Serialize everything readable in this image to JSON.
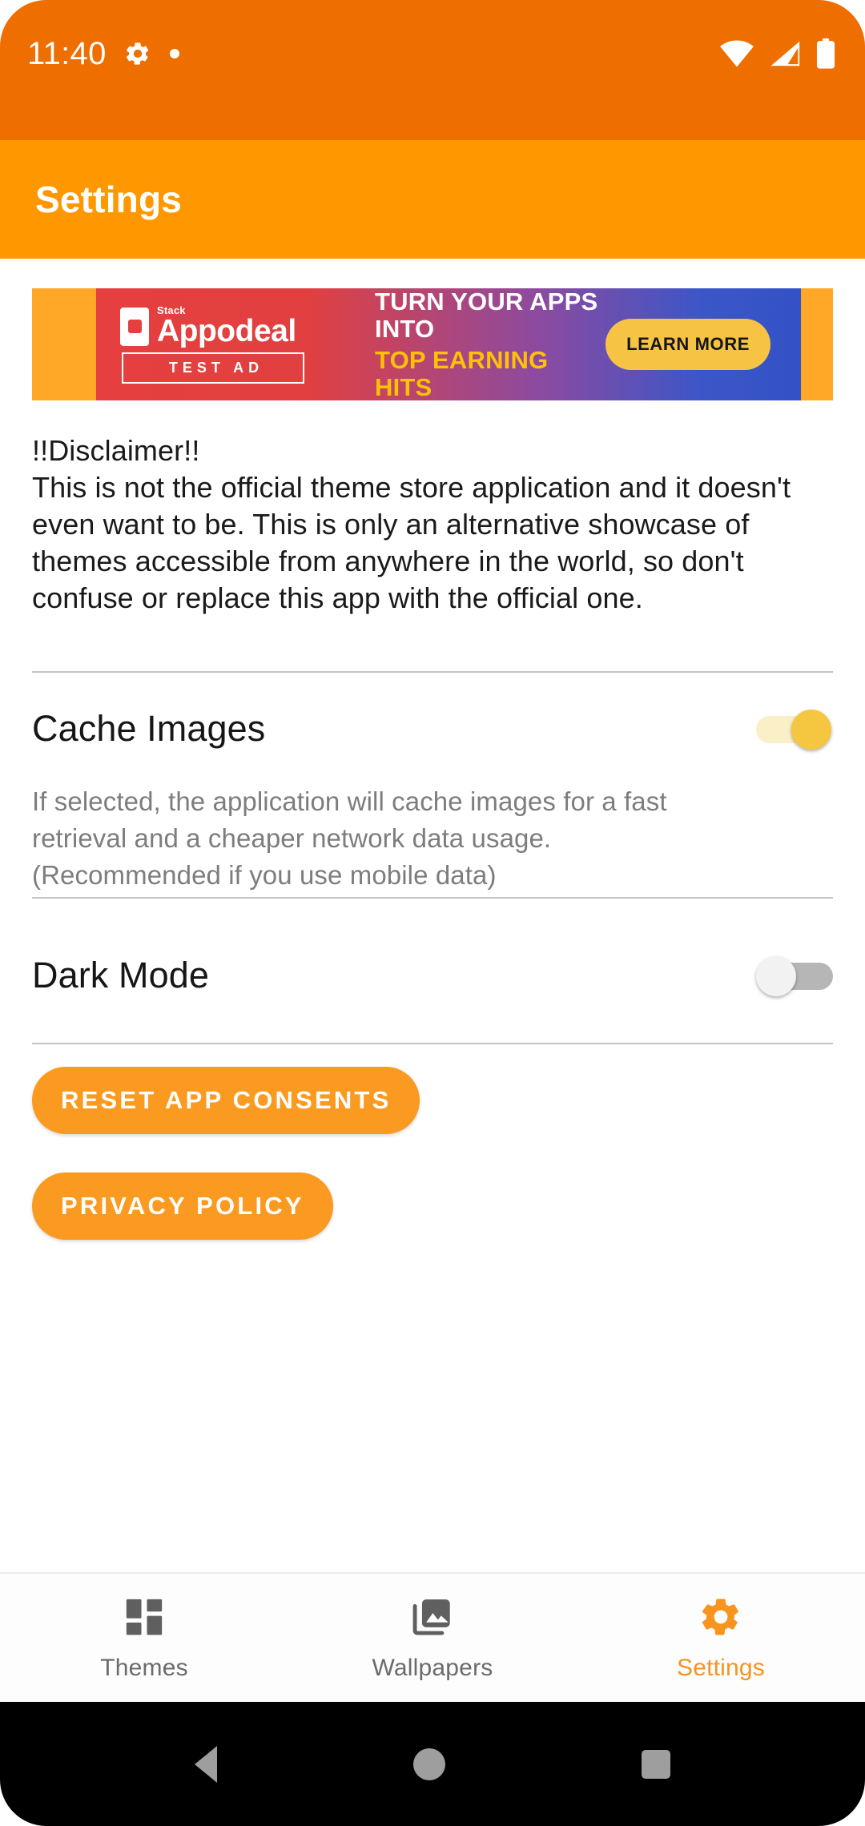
{
  "status_bar": {
    "clock": "11:40",
    "left_icons": [
      "gear-icon",
      "dot-icon"
    ],
    "right_icons": [
      "wifi-icon",
      "cellular-signal-icon",
      "battery-icon"
    ],
    "background_color": "#EE6E00"
  },
  "app_bar": {
    "title": "Settings",
    "background_color": "#FF9800",
    "text_color": "#FFFFFF"
  },
  "ad": {
    "brand_sup": "Stack",
    "brand_name": "Appodeal",
    "test_badge": "TEST AD",
    "headline_line1": "TURN YOUR APPS INTO",
    "headline_line2": "TOP EARNING HITS",
    "cta_label": "LEARN MORE",
    "frame_color": "#FFA726",
    "cta_color": "#F6C344",
    "headline_accent_color": "#FFC107"
  },
  "disclaimer": {
    "text": "!!Disclaimer!!\nThis is not the official theme store application and it doesn't even want to be. This is only an alternative showcase of themes accessible from anywhere in the world, so don't confuse or replace this app with the official one."
  },
  "preferences": [
    {
      "title": "Cache Images",
      "summary": "If selected, the application will cache images for a fast retrieval and a cheaper network data usage. (Recommended if you use mobile data)",
      "checked": true,
      "thumb_color": "#F5C63F",
      "track_color": "#FAEFC6"
    },
    {
      "title": "Dark Mode",
      "summary": "",
      "checked": false,
      "thumb_color": "#F2F2F2",
      "track_color": "#B6B6B6"
    }
  ],
  "buttons": {
    "reset_consents": "RESET APP CONSENTS",
    "privacy_policy": "PRIVACY POLICY",
    "color": "#FB9A20",
    "text_color": "#FFFFFF"
  },
  "bottom_nav": {
    "active_color": "#F7941E",
    "inactive_color": "#6B6B6B",
    "items": [
      {
        "label": "Themes",
        "icon": "dashboard-grid-icon",
        "active": false
      },
      {
        "label": "Wallpapers",
        "icon": "photo-library-icon",
        "active": false
      },
      {
        "label": "Settings",
        "icon": "gear-icon",
        "active": true
      }
    ]
  },
  "system_nav": {
    "items": [
      "back-icon",
      "home-icon",
      "recents-icon"
    ],
    "icon_color": "#9E9E9E",
    "background_color": "#000000"
  }
}
